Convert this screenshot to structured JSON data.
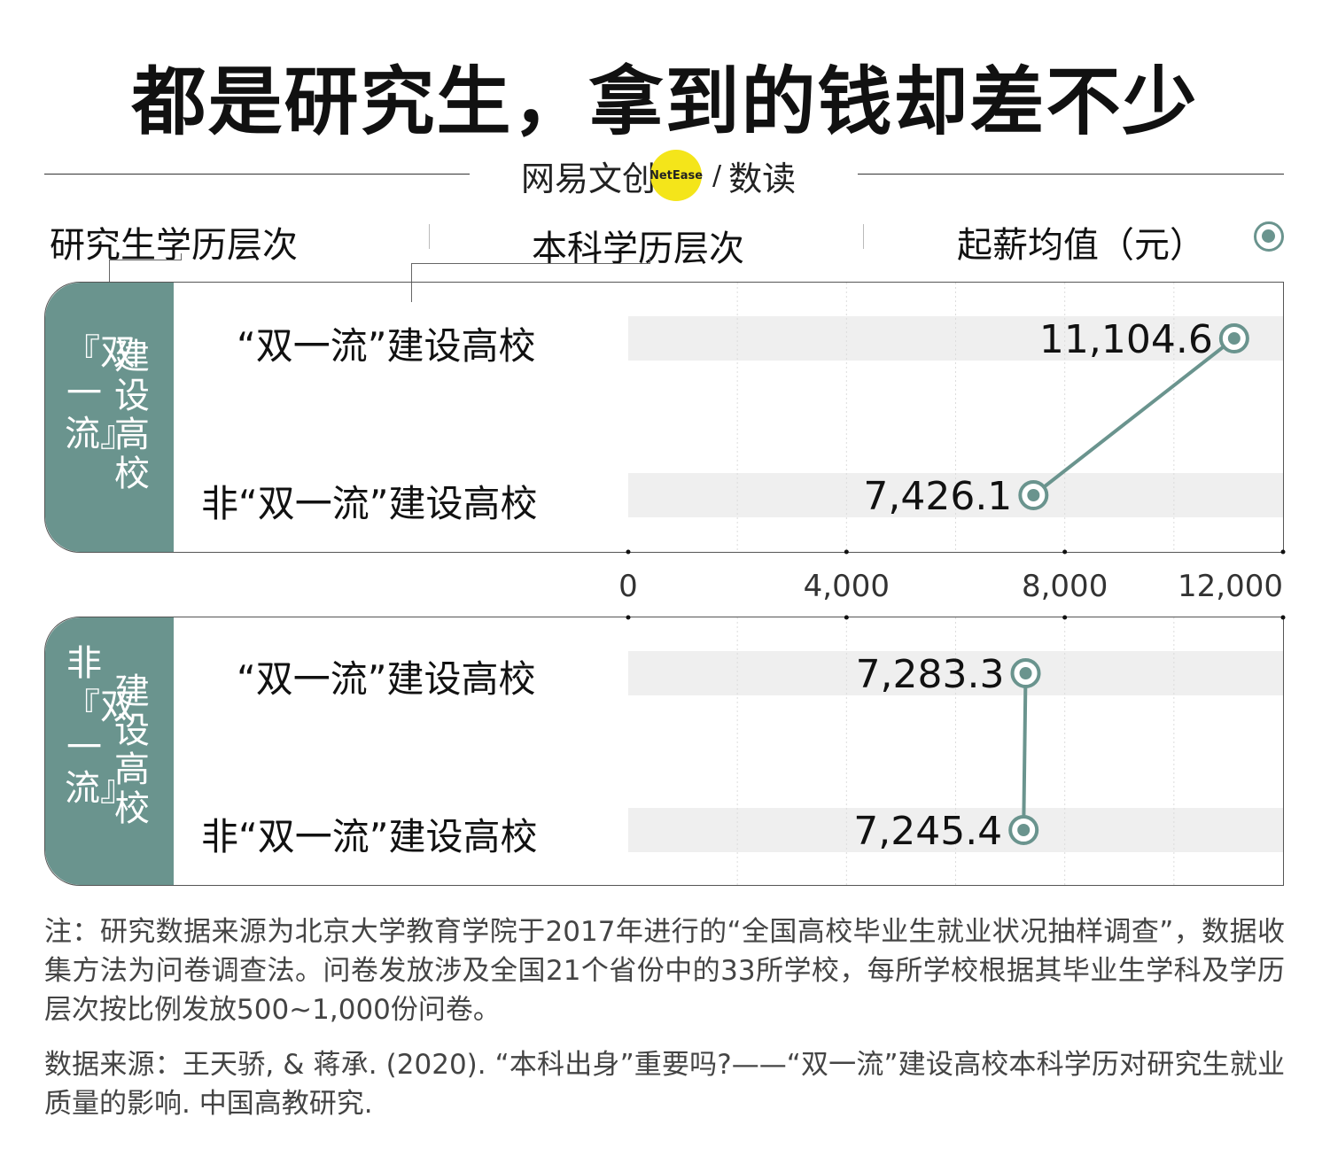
{
  "title": "都是研究生，拿到的钱却差不少",
  "brand": {
    "name": "网易文创",
    "badge": "NetEase",
    "sub": "数读"
  },
  "legend": {
    "grad_level": "研究生学历层次",
    "undergrad_level": "本科学历层次",
    "value_label": "起薪均值（元）",
    "marker_icon": "circle-dot-icon"
  },
  "panels": [
    {
      "side_label_bracket_top": "『双一流』",
      "side_label_main": "建设高校",
      "rows": [
        "“双一流”建设高校",
        "非“双一流”建设高校"
      ]
    },
    {
      "side_label_prefix": "非",
      "side_label_bracket_top": "『双一流』",
      "side_label_main": "建设高校",
      "rows": [
        "“双一流”建设高校",
        "非“双一流”建设高校"
      ]
    }
  ],
  "colors": {
    "accent": "#6a948e",
    "row_band": "#efefef",
    "brand_dot": "#f4e51a"
  },
  "chart_data": {
    "type": "dot",
    "title": "都是研究生，拿到的钱却差不少",
    "xlabel": "起薪均值（元）",
    "xlim": [
      0,
      12000
    ],
    "x_ticks": [
      "0",
      "4,000",
      "8,000",
      "12,000"
    ],
    "groups": [
      {
        "group": "『双一流』建设高校",
        "points": [
          {
            "category": "“双一流”建设高校",
            "value": 11104.6,
            "label": "11,104.6"
          },
          {
            "category": "非“双一流”建设高校",
            "value": 7426.1,
            "label": "7,426.1"
          }
        ]
      },
      {
        "group": "非『双一流』建设高校",
        "points": [
          {
            "category": "“双一流”建设高校",
            "value": 7283.3,
            "label": "7,283.3"
          },
          {
            "category": "非“双一流”建设高校",
            "value": 7245.4,
            "label": "7,245.4"
          }
        ]
      }
    ]
  },
  "notes": {
    "note": "注：研究数据来源为北京大学教育学院于2017年进行的“全国高校毕业生就业状况抽样调查”，数据收集方法为问卷调查法。问卷发放涉及全国21个省份中的33所学校，每所学校根据其毕业生学科及学历层次按比例发放500~1,000份问卷。",
    "source": "数据来源：王天骄, & 蒋承. (2020). “本科出身”重要吗?——“双一流”建设高校本科学历对研究生就业质量的影响. 中国高教研究."
  }
}
